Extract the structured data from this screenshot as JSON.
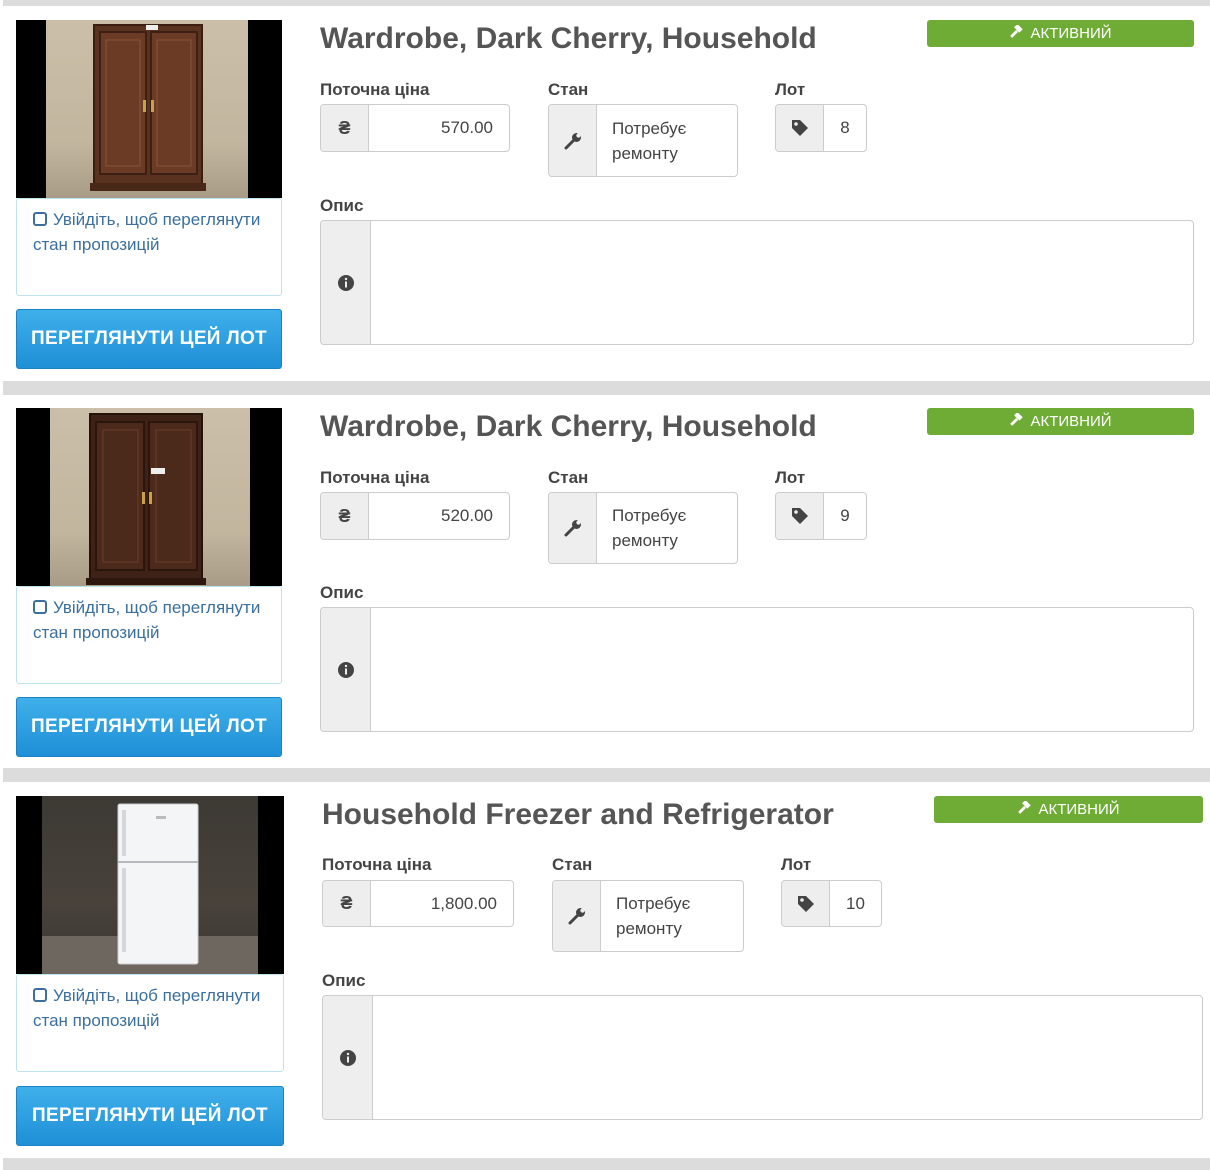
{
  "lots": [
    {
      "title": "Wardrobe, Dark Cherry, Household",
      "status": "АКТИВНИЙ",
      "price_label": "Поточна ціна",
      "currency_symbol": "₴",
      "price": "570.00",
      "condition_label": "Стан",
      "condition": "Потребує ремонту",
      "lot_label": "Лот",
      "lot_number": "8",
      "description_label": "Опис",
      "description": "",
      "login_prompt": "Увійдіть, щоб переглянути стан пропозицій",
      "view_button": "ПЕРЕГЛЯНУТИ ЦЕЙ ЛОТ"
    },
    {
      "title": "Wardrobe, Dark Cherry, Household",
      "status": "АКТИВНИЙ",
      "price_label": "Поточна ціна",
      "currency_symbol": "₴",
      "price": "520.00",
      "condition_label": "Стан",
      "condition": "Потребує ремонту",
      "lot_label": "Лот",
      "lot_number": "9",
      "description_label": "Опис",
      "description": "",
      "login_prompt": "Увійдіть, щоб переглянути стан пропозицій",
      "view_button": "ПЕРЕГЛЯНУТИ ЦЕЙ ЛОТ"
    },
    {
      "title": "Household Freezer and Refrigerator",
      "status": "АКТИВНИЙ",
      "price_label": "Поточна ціна",
      "currency_symbol": "₴",
      "price": "1,800.00",
      "condition_label": "Стан",
      "condition": "Потребує ремонту",
      "lot_label": "Лот",
      "lot_number": "10",
      "description_label": "Опис",
      "description": "",
      "login_prompt": "Увійдіть, щоб переглянути стан пропозицій",
      "view_button": "ПЕРЕГЛЯНУТИ ЦЕЙ ЛОТ"
    }
  ],
  "icons": {
    "status": "gavel-icon",
    "price": "hryvnia-icon",
    "condition": "wrench-icon",
    "lot": "tag-icon",
    "description": "info-circle-icon",
    "login": "checkbox-icon"
  },
  "colors": {
    "active_badge": "#6fac35",
    "view_button": "#2a9be0",
    "login_text": "#3a6f9e"
  }
}
